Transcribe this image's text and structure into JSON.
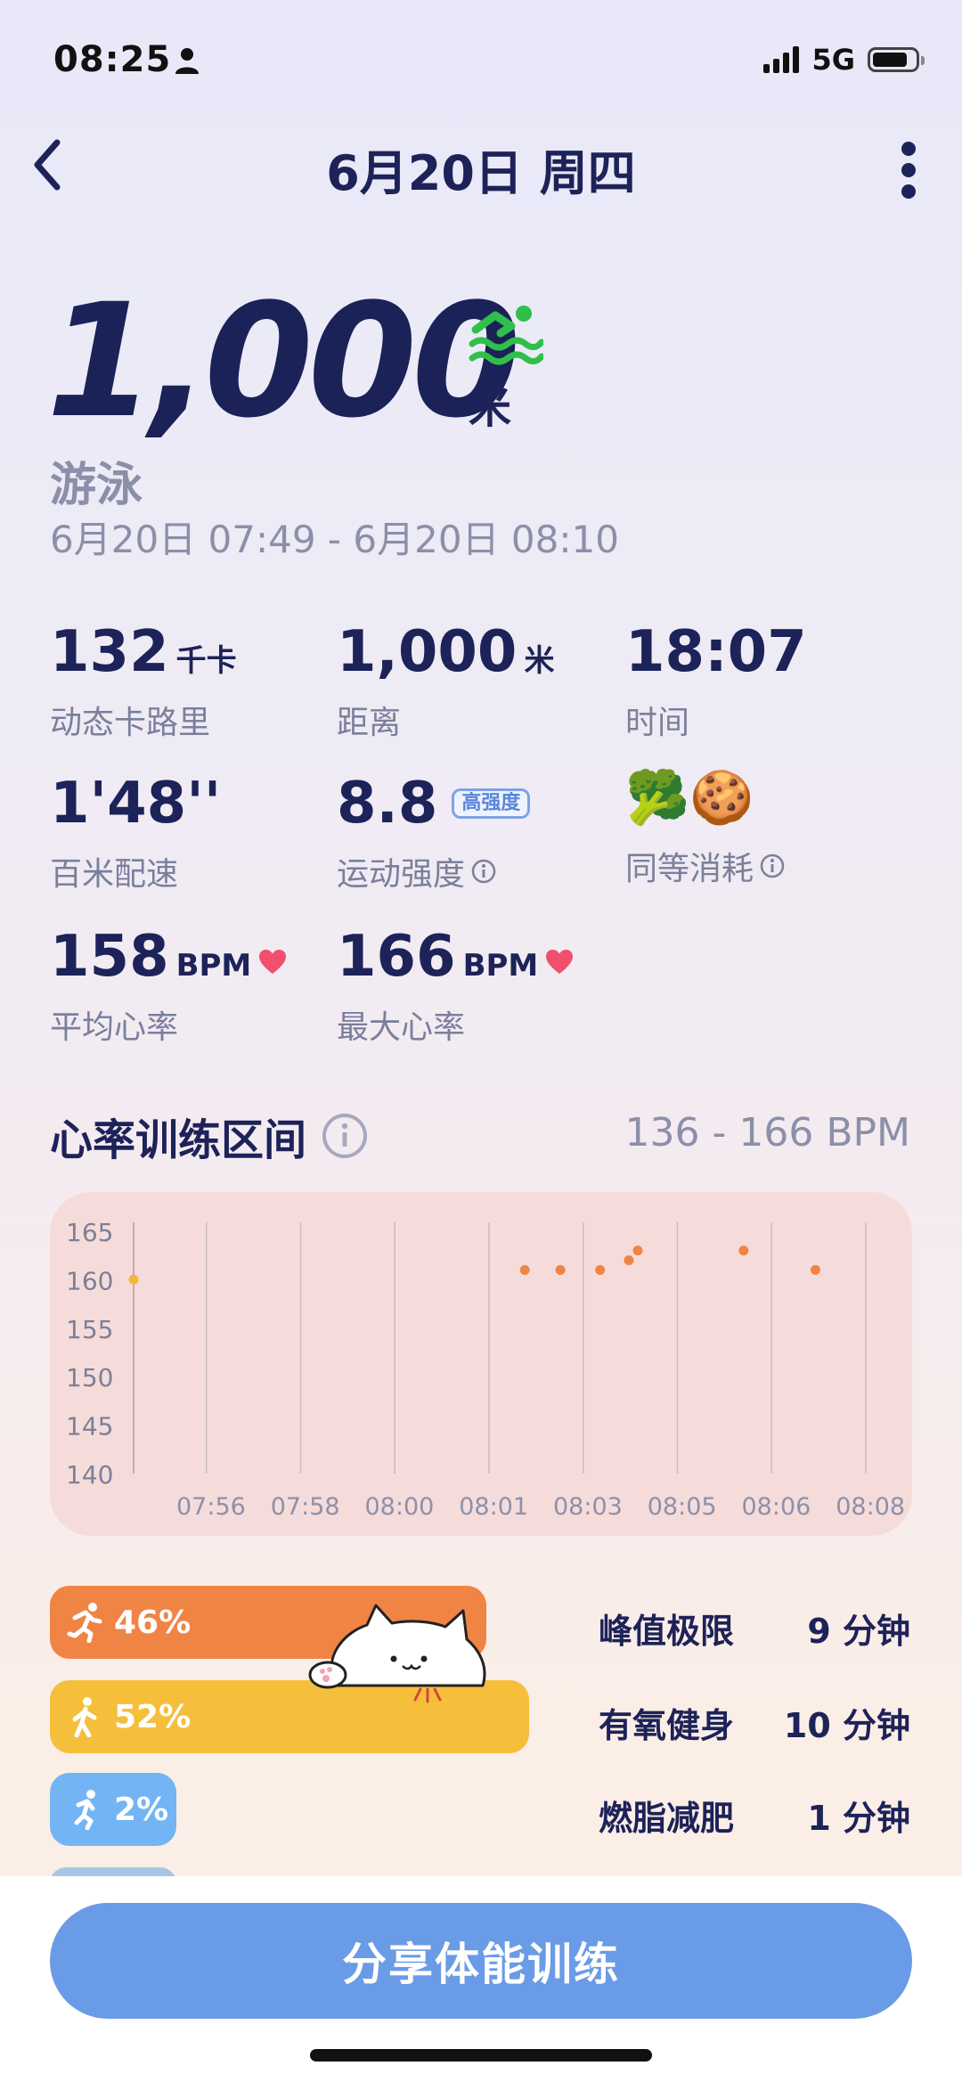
{
  "status": {
    "time": "08:25",
    "network": "5G"
  },
  "nav": {
    "title": "6月20日 周四"
  },
  "summary": {
    "distance": "1,000",
    "unit": "米",
    "sport": "游泳",
    "range": "6月20日 07:49 - 6月20日 08:10"
  },
  "metrics": [
    {
      "value": "132",
      "unit": "千卡",
      "label": "动态卡路里"
    },
    {
      "value": "1,000",
      "unit": "米",
      "label": "距离"
    },
    {
      "value": "18:07",
      "unit": "",
      "label": "时间"
    },
    {
      "value": "1'48''",
      "unit": "",
      "label": "百米配速"
    },
    {
      "value": "8.8",
      "badge": "高强度",
      "label": "运动强度"
    },
    {
      "foods": "🥦🍪",
      "label": "同等消耗"
    },
    {
      "value": "158",
      "unit": "BPM",
      "label": "平均心率"
    },
    {
      "value": "166",
      "unit": "BPM",
      "label": "最大心率"
    }
  ],
  "zones_header": {
    "title": "心率训练区间",
    "range": "136 - 166 BPM"
  },
  "colors": {
    "peak": "#f08445",
    "aerobic": "#f5bf3c",
    "fatburn": "#73b4f4",
    "accent": "#6a9be6",
    "heart": "#f0506e",
    "swim": "#2fbf4a"
  },
  "chart_data": {
    "type": "scatter",
    "y_ticks": [
      "165",
      "160",
      "155",
      "150",
      "145",
      "140"
    ],
    "ylim": [
      140,
      165
    ],
    "x_ticks": [
      "07:56",
      "07:58",
      "08:00",
      "08:01",
      "08:03",
      "08:05",
      "08:06",
      "08:08"
    ],
    "grid": true,
    "series": [
      {
        "points": [
          {
            "x": "07:49",
            "y": 160
          },
          {
            "x": "08:00",
            "y": 161
          },
          {
            "x": "08:00",
            "y": 161
          },
          {
            "x": "08:02",
            "y": 161
          },
          {
            "x": "08:03",
            "y": 162
          },
          {
            "x": "08:03",
            "y": 163
          },
          {
            "x": "08:06",
            "y": 163
          },
          {
            "x": "08:08",
            "y": 161
          }
        ]
      }
    ]
  },
  "zones": [
    {
      "percent": "46%",
      "name": "峰值极限",
      "duration": "9 分钟",
      "share": 0.46
    },
    {
      "percent": "52%",
      "name": "有氧健身",
      "duration": "10 分钟",
      "share": 0.52
    },
    {
      "percent": "2%",
      "name": "燃脂减肥",
      "duration": "1 分钟",
      "share": 0.02
    }
  ],
  "share_button": "分享体能训练"
}
